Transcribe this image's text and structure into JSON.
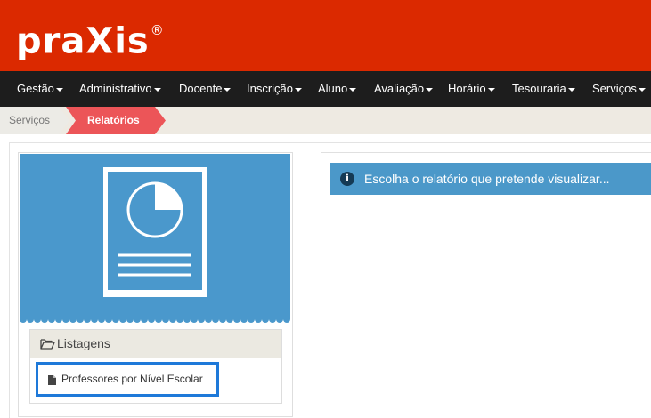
{
  "brand": {
    "name": "praXis",
    "registered": "®"
  },
  "colors": {
    "header": "#db2900",
    "navbar": "#1d1d1d",
    "breadcrumb_active": "#ec5558",
    "card_blue": "#4a98cc",
    "alert_blue": "#4b98c9",
    "highlight": "#1e79d9"
  },
  "nav": {
    "items": [
      {
        "label": "Gestão"
      },
      {
        "label": "Administrativo"
      },
      {
        "label": "Docente"
      },
      {
        "label": "Inscrição"
      },
      {
        "label": "Aluno"
      },
      {
        "label": "Avaliação"
      },
      {
        "label": "Horário"
      },
      {
        "label": "Tesouraria"
      },
      {
        "label": "Serviços"
      }
    ]
  },
  "breadcrumb": {
    "items": [
      "Serviços",
      "Relatórios"
    ],
    "active_index": 1
  },
  "report_card": {
    "icon": "report-document-pie-icon",
    "section_title": "Listagens",
    "section_icon": "folder-open-icon",
    "items": [
      {
        "label": "Professores por Nível Escolar",
        "icon": "file-icon"
      }
    ]
  },
  "alert": {
    "icon": "info-icon",
    "text": "Escolha o relatório que pretende visualizar..."
  }
}
